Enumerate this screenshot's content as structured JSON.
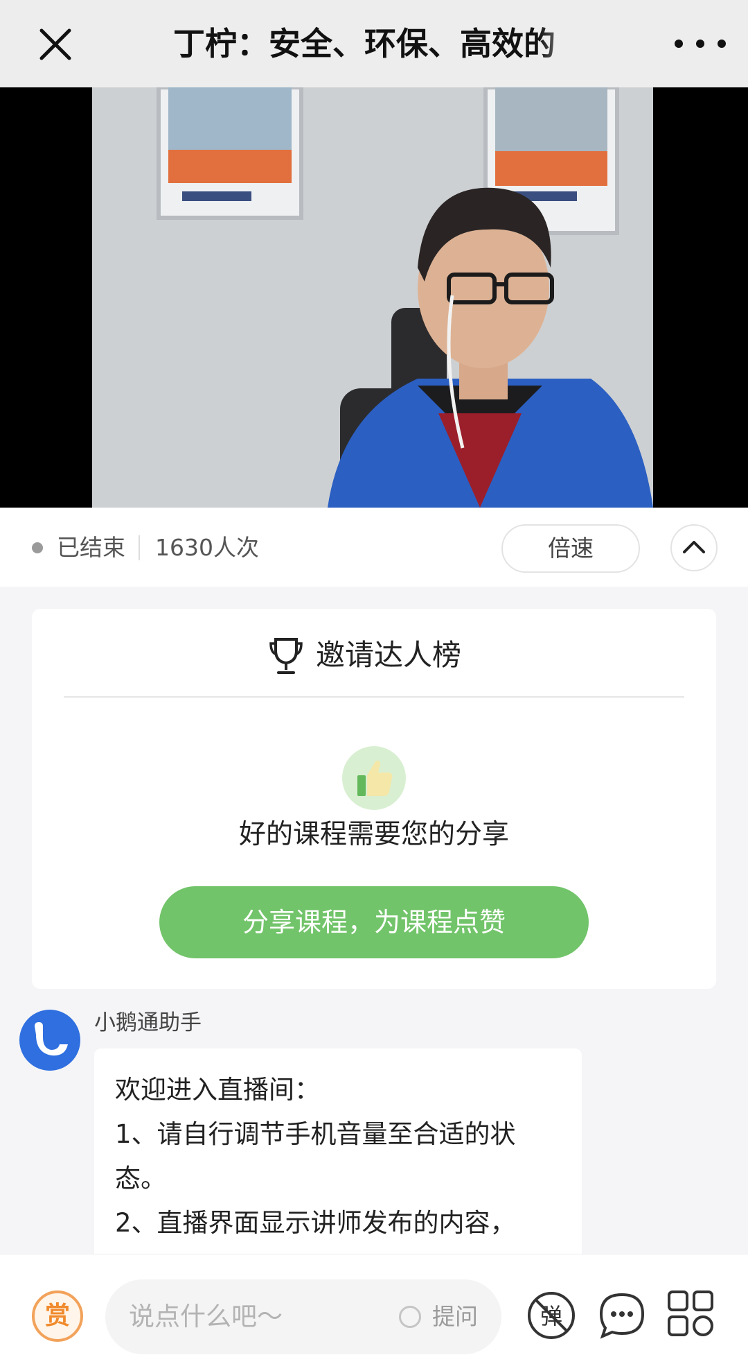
{
  "header": {
    "title": "丁柠：安全、环保、高效的",
    "close_icon": "close-icon",
    "more_icon": "more-icon"
  },
  "video": {
    "description_icon": "video-player"
  },
  "status": {
    "state": "已结束",
    "views": "1630人次",
    "speed_label": "倍速"
  },
  "invite_card": {
    "title": "邀请达人榜",
    "subtitle": "好的课程需要您的分享",
    "share_button": "分享课程，为课程点赞",
    "accent_color": "#72c46a"
  },
  "message": {
    "sender": "小鹅通助手",
    "lines": [
      "欢迎进入直播间：",
      "1、请自行调节手机音量至合适的状",
      "态。",
      "2、直播界面显示讲师发布的内容，"
    ]
  },
  "bottom_bar": {
    "reward_label": "赏",
    "input_placeholder": "说点什么吧～",
    "ask_label": "提问",
    "danmu_label": "弹"
  }
}
